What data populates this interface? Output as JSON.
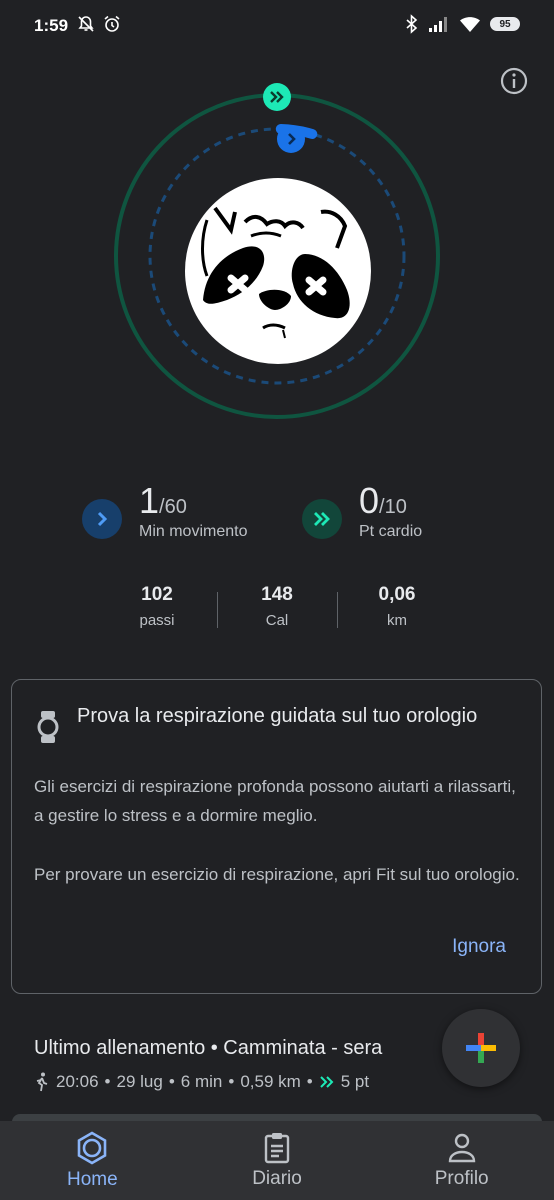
{
  "status_bar": {
    "time": "1:59",
    "battery": "95",
    "icons": [
      "mute-icon",
      "alarm-icon",
      "bluetooth-icon",
      "signal-icon",
      "wifi-icon",
      "battery-icon"
    ]
  },
  "goals": {
    "move_minutes": {
      "value": "1",
      "goal": "/60",
      "label": "Min movimento",
      "progress": 0.017,
      "color": "#1a73e8"
    },
    "heart_points": {
      "value": "0",
      "goal": "/10",
      "label": "Pt cardio",
      "progress": 0.0,
      "color": "#1de9b6"
    }
  },
  "metrics": [
    {
      "value": "102",
      "label": "passi"
    },
    {
      "value": "148",
      "label": "Cal"
    },
    {
      "value": "0,06",
      "label": "km"
    }
  ],
  "card": {
    "title": "Prova la respirazione guidata sul tuo orologio",
    "paragraph1": "Gli esercizi di respirazione profonda possono aiutarti a rilassarti, a gestire lo stress e a dormire meglio.",
    "paragraph2": "Per provare un esercizio di respirazione, apri Fit sul tuo orologio.",
    "dismiss": "Ignora"
  },
  "last_workout": {
    "title": "Ultimo allenamento • Camminata - sera",
    "time": "20:06",
    "date": "29 lug",
    "duration": "6 min",
    "distance": "0,59 km",
    "points": "5 pt"
  },
  "bottom_nav": {
    "items": [
      {
        "label": "Home",
        "active": true
      },
      {
        "label": "Diario",
        "active": false
      },
      {
        "label": "Profilo",
        "active": false
      }
    ]
  },
  "colors": {
    "accent": "#8ab4f8",
    "move_blue": "#1a73e8",
    "heart_green": "#1de9b6",
    "ring_green": "#0f5540"
  }
}
